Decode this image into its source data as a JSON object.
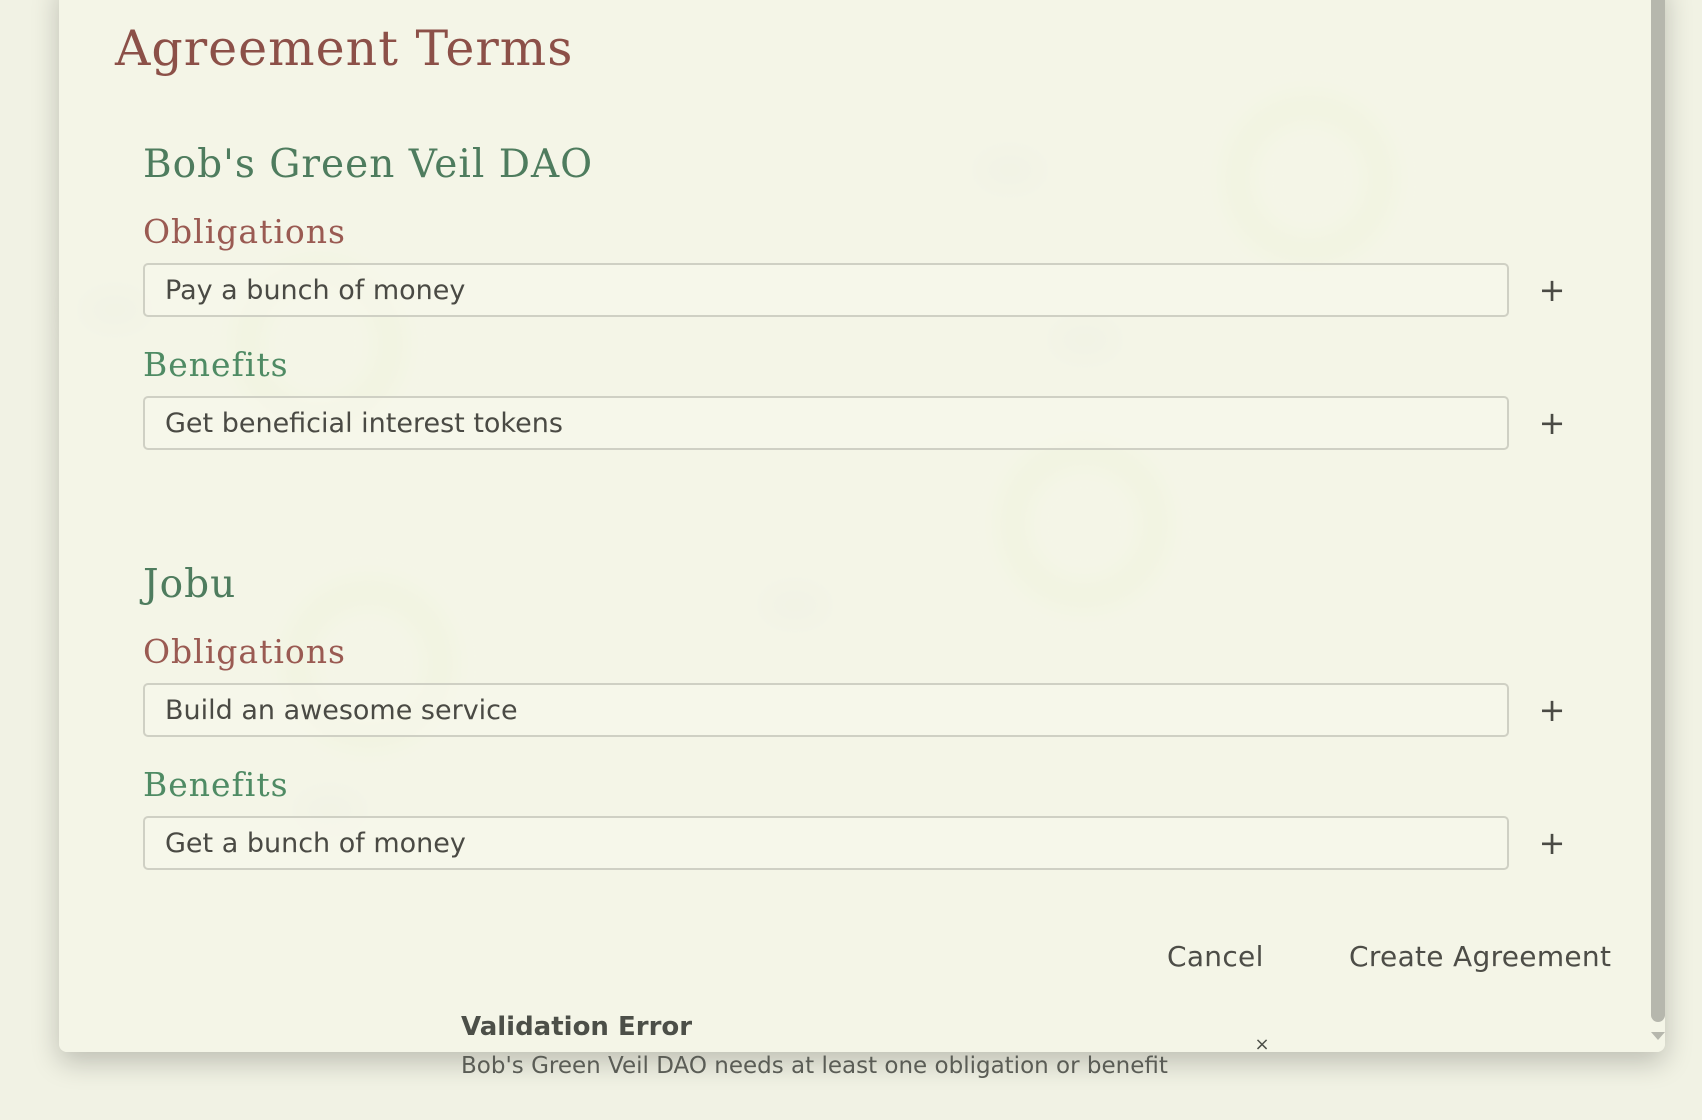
{
  "dialog": {
    "title": "Agreement Terms",
    "parties": [
      {
        "name": "Bob's Green Veil DAO",
        "obligations_label": "Obligations",
        "obligation_value": "Pay a bunch of money",
        "benefits_label": "Benefits",
        "benefit_value": "Get beneficial interest tokens",
        "add_symbol": "+"
      },
      {
        "name": "Jobu",
        "obligations_label": "Obligations",
        "obligation_value": "Build an awesome service",
        "benefits_label": "Benefits",
        "benefit_value": "Get a bunch of money",
        "add_symbol": "+"
      }
    ],
    "cancel_label": "Cancel",
    "create_label": "Create Agreement"
  },
  "toast": {
    "title": "Validation Error",
    "message": "Bob's Green Veil DAO needs at least one obligation or benefit",
    "close_symbol": "×"
  },
  "colors": {
    "background": "#f1f2e4",
    "title": "#8c5048",
    "party_name": "#4e7c5e",
    "obligations": "#9a5a52",
    "benefits": "#4f8b64",
    "graph_ring": "#dde7b4"
  },
  "icons": {
    "add": "plus-icon",
    "close": "close-icon",
    "scroll": "chevron-down-icon"
  }
}
